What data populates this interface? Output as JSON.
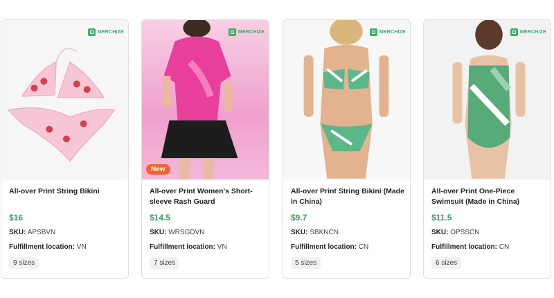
{
  "brand": {
    "name": "MERCHIZE"
  },
  "labels": {
    "sku": "SKU:",
    "fulfillment": "Fulfillment location:"
  },
  "products": [
    {
      "title": "All-over Print String Bikini",
      "price": "$16",
      "sku": "APSBVN",
      "location": "VN",
      "sizes": "9 sizes"
    },
    {
      "title": "All-over Print Women's Short-sleeve Rash Guard",
      "price": "$14.5",
      "sku": "WRSGDVN",
      "location": "VN",
      "sizes": "7 sizes",
      "badge": "New"
    },
    {
      "title": "All-over Print String Bikini (Made in China)",
      "price": "$9.7",
      "sku": "SBKNCN",
      "location": "CN",
      "sizes": "5 sizes"
    },
    {
      "title": "All-over Print One-Piece Swimsuit (Made in China)",
      "price": "$11.5",
      "sku": "OPSSCN",
      "location": "CN",
      "sizes": "6 sizes"
    }
  ],
  "colors": {
    "price": "#2fa35f",
    "brand": "#3fae6c",
    "badge": "#f2622e"
  }
}
